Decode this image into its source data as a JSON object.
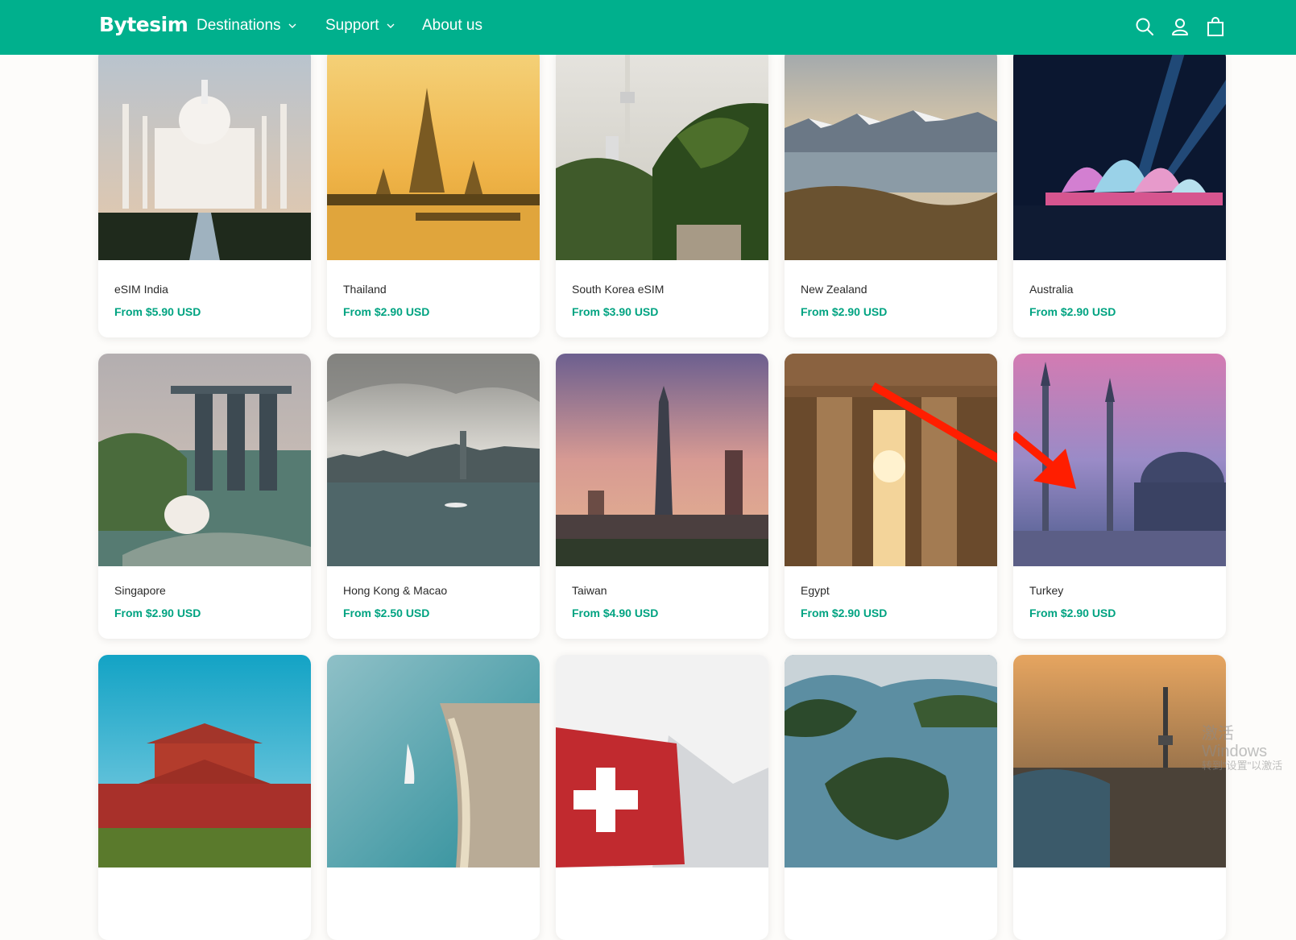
{
  "header": {
    "logo": "Bytesim",
    "nav": [
      {
        "label": "Destinations",
        "dropdown": true
      },
      {
        "label": "Support",
        "dropdown": true
      },
      {
        "label": "About us",
        "dropdown": false
      }
    ],
    "icons": [
      "search-icon",
      "account-icon",
      "cart-icon"
    ],
    "bg_color": "#00b08d"
  },
  "products": [
    {
      "name": "eSIM India",
      "price": "From $5.90 USD"
    },
    {
      "name": "Thailand",
      "price": "From $2.90 USD"
    },
    {
      "name": "South Korea eSIM",
      "price": "From $3.90 USD"
    },
    {
      "name": "New Zealand",
      "price": "From $2.90 USD"
    },
    {
      "name": "Australia",
      "price": "From $2.90 USD"
    },
    {
      "name": "Singapore",
      "price": "From $2.90 USD"
    },
    {
      "name": "Hong Kong & Macao",
      "price": "From $2.50 USD"
    },
    {
      "name": "Taiwan",
      "price": "From $4.90 USD"
    },
    {
      "name": "Egypt",
      "price": "From $2.90 USD"
    },
    {
      "name": "Turkey",
      "price": "From $2.90 USD"
    },
    {
      "name": "",
      "price": ""
    },
    {
      "name": "",
      "price": ""
    },
    {
      "name": "",
      "price": ""
    },
    {
      "name": "",
      "price": ""
    },
    {
      "name": "",
      "price": ""
    }
  ],
  "watermark": {
    "line1": "激活 Windows",
    "line2": "转到\"设置\"以激活"
  },
  "accent_color": "#00a381"
}
